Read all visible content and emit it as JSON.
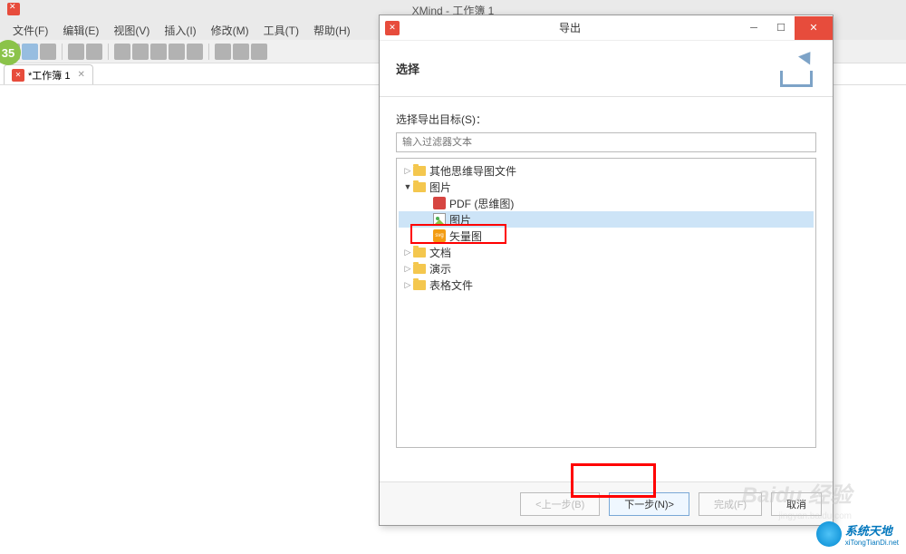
{
  "main": {
    "title": "XMind - 工作簿 1",
    "badge": "35",
    "menu": [
      "文件(F)",
      "编辑(E)",
      "视图(V)",
      "插入(I)",
      "修改(M)",
      "工具(T)",
      "帮助(H)"
    ],
    "tab": {
      "label": "*工作簿 1"
    }
  },
  "dialog": {
    "title": "导出",
    "header": "选择",
    "body_label": "选择导出目标(S)：",
    "filter_placeholder": "输入过滤器文本",
    "tree": {
      "items": [
        {
          "label": "其他思维导图文件",
          "type": "folder",
          "indent": 0,
          "expanded": false
        },
        {
          "label": "图片",
          "type": "folder",
          "indent": 0,
          "expanded": true
        },
        {
          "label": "PDF (思维图)",
          "type": "pdf",
          "indent": 2
        },
        {
          "label": "图片",
          "type": "img",
          "indent": 2,
          "selected": true
        },
        {
          "label": "矢量图",
          "type": "svg",
          "indent": 2
        },
        {
          "label": "文档",
          "type": "folder",
          "indent": 0,
          "expanded": false
        },
        {
          "label": "演示",
          "type": "folder",
          "indent": 0,
          "expanded": false
        },
        {
          "label": "表格文件",
          "type": "folder",
          "indent": 0,
          "expanded": false
        }
      ]
    },
    "buttons": {
      "back": "<上一步(B)",
      "next": "下一步(N)>",
      "finish": "完成(F)",
      "cancel": "取消"
    }
  },
  "watermark": {
    "main": "Baidu 经验",
    "sub": "jingyan.baidu.com",
    "logo": "系统天地",
    "logo_sub": "xiTongTianDi.net"
  }
}
